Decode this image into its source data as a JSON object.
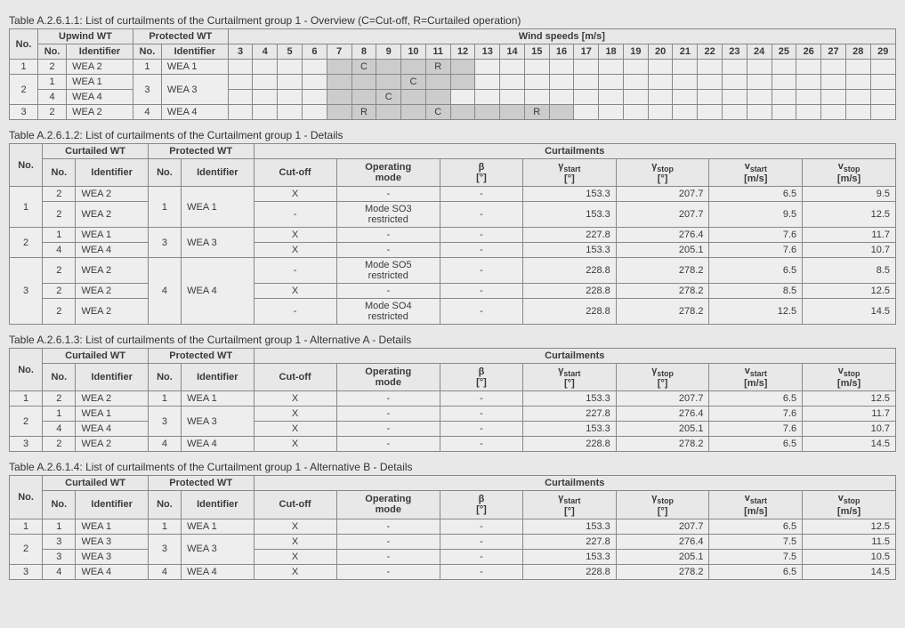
{
  "tables": {
    "overview": {
      "caption": "Table A.2.6.1.1: List of curtailments of the Curtailment group 1 - Overview (C=Cut-off, R=Curtailed operation)",
      "group_headers": {
        "upwind": "Upwind WT",
        "protected": "Protected WT",
        "windspeeds": "Wind speeds [m/s]"
      },
      "col_headers": {
        "no": "No.",
        "identifier": "Identifier"
      },
      "wind_speeds": [
        3,
        4,
        5,
        6,
        7,
        8,
        9,
        10,
        11,
        12,
        13,
        14,
        15,
        16,
        17,
        18,
        19,
        20,
        21,
        22,
        23,
        24,
        25,
        26,
        27,
        28,
        29
      ],
      "rows": [
        {
          "no": "1",
          "upwind": [
            {
              "no": "2",
              "id": "WEA 2"
            }
          ],
          "protected": {
            "no": "1",
            "id": "WEA 1"
          },
          "cells": [
            "",
            "",
            "",
            "",
            "fill",
            "C",
            "fill",
            "fill",
            "R",
            "fill",
            "",
            "",
            "",
            "",
            "",
            "",
            "",
            "",
            "",
            "",
            "",
            "",
            "",
            "",
            "",
            "",
            ""
          ]
        },
        {
          "no": "2",
          "upwind": [
            {
              "no": "1",
              "id": "WEA 1"
            },
            {
              "no": "4",
              "id": "WEA 4"
            }
          ],
          "protected": {
            "no": "3",
            "id": "WEA 3"
          },
          "cells_rows": [
            [
              "",
              "",
              "",
              "",
              "fill",
              "fill",
              "fill",
              "C",
              "fill",
              "fill",
              "",
              "",
              "",
              "",
              "",
              "",
              "",
              "",
              "",
              "",
              "",
              "",
              "",
              "",
              "",
              "",
              ""
            ],
            [
              "",
              "",
              "",
              "",
              "fill",
              "fill",
              "C",
              "fill",
              "fill",
              "",
              "",
              "",
              "",
              "",
              "",
              "",
              "",
              "",
              "",
              "",
              "",
              "",
              "",
              "",
              "",
              "",
              ""
            ]
          ]
        },
        {
          "no": "3",
          "upwind": [
            {
              "no": "2",
              "id": "WEA 2"
            }
          ],
          "protected": {
            "no": "4",
            "id": "WEA 4"
          },
          "cells": [
            "",
            "",
            "",
            "",
            "fill",
            "R",
            "fill",
            "fill",
            "C",
            "fill",
            "fill",
            "fill",
            "R",
            "fill",
            "",
            "",
            "",
            "",
            "",
            "",
            "",
            "",
            "",
            "",
            "",
            "",
            ""
          ]
        }
      ]
    },
    "details": {
      "caption": "Table A.2.6.1.2: List of curtailments of the Curtailment group 1 - Details",
      "group_headers": {
        "curtailed": "Curtailed WT",
        "protected": "Protected WT",
        "curtailments": "Curtailments"
      },
      "col_headers": {
        "no": "No.",
        "identifier": "Identifier",
        "cutoff": "Cut-off",
        "opmode": "Operating mode",
        "beta": "β [°]",
        "gstart": "γstart [°]",
        "gstop": "γstop [°]",
        "vstart": "vstart [m/s]",
        "vstop": "vstop [m/s]"
      },
      "rows": [
        {
          "no": "1",
          "curtailed": [
            {
              "no": "2",
              "id": "WEA 2"
            },
            {
              "no": "2",
              "id": "WEA 2"
            }
          ],
          "protected": {
            "no": "1",
            "id": "WEA 1"
          },
          "data": [
            {
              "cutoff": "X",
              "opmode": "-",
              "beta": "-",
              "gstart": "153.3",
              "gstop": "207.7",
              "vstart": "6.5",
              "vstop": "9.5"
            },
            {
              "cutoff": "-",
              "opmode": "Mode SO3 restricted",
              "beta": "-",
              "gstart": "153.3",
              "gstop": "207.7",
              "vstart": "9.5",
              "vstop": "12.5"
            }
          ]
        },
        {
          "no": "2",
          "curtailed": [
            {
              "no": "1",
              "id": "WEA 1"
            },
            {
              "no": "4",
              "id": "WEA 4"
            }
          ],
          "protected": {
            "no": "3",
            "id": "WEA 3"
          },
          "data": [
            {
              "cutoff": "X",
              "opmode": "-",
              "beta": "-",
              "gstart": "227.8",
              "gstop": "276.4",
              "vstart": "7.6",
              "vstop": "11.7"
            },
            {
              "cutoff": "X",
              "opmode": "-",
              "beta": "-",
              "gstart": "153.3",
              "gstop": "205.1",
              "vstart": "7.6",
              "vstop": "10.7"
            }
          ]
        },
        {
          "no": "3",
          "curtailed": [
            {
              "no": "2",
              "id": "WEA 2"
            },
            {
              "no": "2",
              "id": "WEA 2"
            },
            {
              "no": "2",
              "id": "WEA 2"
            }
          ],
          "protected": {
            "no": "4",
            "id": "WEA 4"
          },
          "data": [
            {
              "cutoff": "-",
              "opmode": "Mode SO5 restricted",
              "beta": "-",
              "gstart": "228.8",
              "gstop": "278.2",
              "vstart": "6.5",
              "vstop": "8.5"
            },
            {
              "cutoff": "X",
              "opmode": "-",
              "beta": "-",
              "gstart": "228.8",
              "gstop": "278.2",
              "vstart": "8.5",
              "vstop": "12.5"
            },
            {
              "cutoff": "-",
              "opmode": "Mode SO4 restricted",
              "beta": "-",
              "gstart": "228.8",
              "gstop": "278.2",
              "vstart": "12.5",
              "vstop": "14.5"
            }
          ]
        }
      ]
    },
    "alt_a": {
      "caption": "Table A.2.6.1.3: List of curtailments of the Curtailment group 1 - Alternative A - Details",
      "rows": [
        {
          "no": "1",
          "curtailed": [
            {
              "no": "2",
              "id": "WEA 2"
            }
          ],
          "protected": {
            "no": "1",
            "id": "WEA 1"
          },
          "data": [
            {
              "cutoff": "X",
              "opmode": "-",
              "beta": "-",
              "gstart": "153.3",
              "gstop": "207.7",
              "vstart": "6.5",
              "vstop": "12.5"
            }
          ]
        },
        {
          "no": "2",
          "curtailed": [
            {
              "no": "1",
              "id": "WEA 1"
            },
            {
              "no": "4",
              "id": "WEA 4"
            }
          ],
          "protected": {
            "no": "3",
            "id": "WEA 3"
          },
          "data": [
            {
              "cutoff": "X",
              "opmode": "-",
              "beta": "-",
              "gstart": "227.8",
              "gstop": "276.4",
              "vstart": "7.6",
              "vstop": "11.7"
            },
            {
              "cutoff": "X",
              "opmode": "-",
              "beta": "-",
              "gstart": "153.3",
              "gstop": "205.1",
              "vstart": "7.6",
              "vstop": "10.7"
            }
          ]
        },
        {
          "no": "3",
          "curtailed": [
            {
              "no": "2",
              "id": "WEA 2"
            }
          ],
          "protected": {
            "no": "4",
            "id": "WEA 4"
          },
          "data": [
            {
              "cutoff": "X",
              "opmode": "-",
              "beta": "-",
              "gstart": "228.8",
              "gstop": "278.2",
              "vstart": "6.5",
              "vstop": "14.5"
            }
          ]
        }
      ]
    },
    "alt_b": {
      "caption": "Table A.2.6.1.4: List of curtailments of the Curtailment group 1 - Alternative B - Details",
      "rows": [
        {
          "no": "1",
          "curtailed": [
            {
              "no": "1",
              "id": "WEA 1"
            }
          ],
          "protected": {
            "no": "1",
            "id": "WEA 1"
          },
          "data": [
            {
              "cutoff": "X",
              "opmode": "-",
              "beta": "-",
              "gstart": "153.3",
              "gstop": "207.7",
              "vstart": "6.5",
              "vstop": "12.5"
            }
          ]
        },
        {
          "no": "2",
          "curtailed": [
            {
              "no": "3",
              "id": "WEA 3"
            },
            {
              "no": "3",
              "id": "WEA 3"
            }
          ],
          "protected": {
            "no": "3",
            "id": "WEA 3"
          },
          "data": [
            {
              "cutoff": "X",
              "opmode": "-",
              "beta": "-",
              "gstart": "227.8",
              "gstop": "276.4",
              "vstart": "7.5",
              "vstop": "11.5"
            },
            {
              "cutoff": "X",
              "opmode": "-",
              "beta": "-",
              "gstart": "153.3",
              "gstop": "205.1",
              "vstart": "7.5",
              "vstop": "10.5"
            }
          ]
        },
        {
          "no": "3",
          "curtailed": [
            {
              "no": "4",
              "id": "WEA 4"
            }
          ],
          "protected": {
            "no": "4",
            "id": "WEA 4"
          },
          "data": [
            {
              "cutoff": "X",
              "opmode": "-",
              "beta": "-",
              "gstart": "228.8",
              "gstop": "278.2",
              "vstart": "6.5",
              "vstop": "14.5"
            }
          ]
        }
      ]
    }
  }
}
